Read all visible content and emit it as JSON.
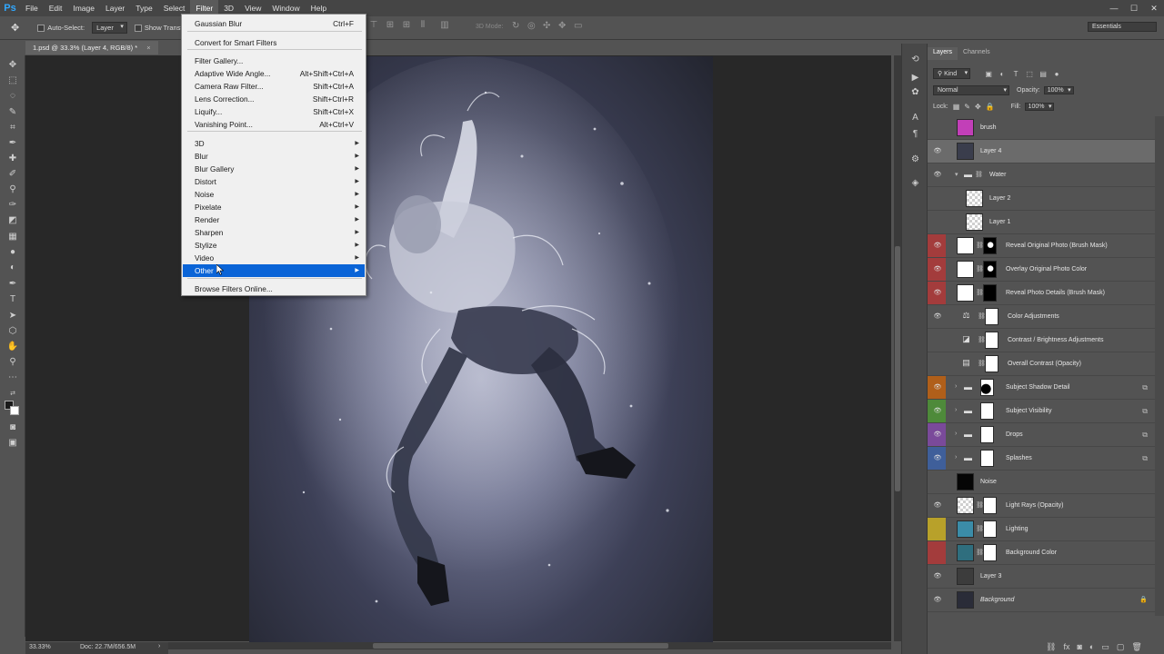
{
  "app": {
    "logo": "Ps"
  },
  "menubar": {
    "items": [
      "File",
      "Edit",
      "Image",
      "Layer",
      "Type",
      "Select",
      "Filter",
      "3D",
      "View",
      "Window",
      "Help"
    ],
    "active": "Filter",
    "window_controls": [
      "—",
      "☐",
      "✕"
    ]
  },
  "options_bar": {
    "auto_select_label": "Auto-Select:",
    "auto_select_value": "Layer",
    "show_transform_label": "Show Transf",
    "mode_3d_label": "3D Mode:",
    "workspace": "Essentials"
  },
  "document_tab": {
    "title": "1.psd @ 33.3% (Layer 4, RGB/8) *",
    "close": "×"
  },
  "filter_menu": {
    "items": [
      {
        "label": "Gaussian Blur",
        "shortcut": "Ctrl+F"
      },
      {
        "label": "Convert for Smart Filters",
        "shortcut": ""
      },
      {
        "label": "Filter Gallery...",
        "shortcut": ""
      },
      {
        "label": "Adaptive Wide Angle...",
        "shortcut": "Alt+Shift+Ctrl+A"
      },
      {
        "label": "Camera Raw Filter...",
        "shortcut": "Shift+Ctrl+A"
      },
      {
        "label": "Lens Correction...",
        "shortcut": "Shift+Ctrl+R"
      },
      {
        "label": "Liquify...",
        "shortcut": "Shift+Ctrl+X"
      },
      {
        "label": "Vanishing Point...",
        "shortcut": "Alt+Ctrl+V"
      },
      {
        "label": "3D",
        "submenu": true
      },
      {
        "label": "Blur",
        "submenu": true
      },
      {
        "label": "Blur Gallery",
        "submenu": true
      },
      {
        "label": "Distort",
        "submenu": true
      },
      {
        "label": "Noise",
        "submenu": true
      },
      {
        "label": "Pixelate",
        "submenu": true
      },
      {
        "label": "Render",
        "submenu": true
      },
      {
        "label": "Sharpen",
        "submenu": true
      },
      {
        "label": "Stylize",
        "submenu": true
      },
      {
        "label": "Video",
        "submenu": true
      },
      {
        "label": "Other",
        "submenu": true,
        "highlighted": true
      },
      {
        "label": "Browse Filters Online...",
        "shortcut": ""
      }
    ]
  },
  "layers_panel": {
    "tabs": [
      "Layers",
      "Channels"
    ],
    "active_tab": "Layers",
    "filter_kind": "Kind",
    "blend_mode": "Normal",
    "opacity_label": "Opacity:",
    "opacity_value": "100%",
    "lock_label": "Lock:",
    "fill_label": "Fill:",
    "fill_value": "100%",
    "layers": [
      {
        "name": "brush",
        "visible": false,
        "type": "pixel",
        "thumb": "#c23fb8"
      },
      {
        "name": "Layer 4",
        "visible": true,
        "type": "pixel",
        "thumb": "#3a3d4c",
        "selected": true
      },
      {
        "name": "Water",
        "visible": true,
        "type": "group",
        "expanded": true
      },
      {
        "name": "Layer 2",
        "visible": false,
        "type": "pixel",
        "thumb": "checker",
        "indent": true
      },
      {
        "name": "Layer 1",
        "visible": false,
        "type": "pixel",
        "thumb": "checker",
        "indent": true
      },
      {
        "name": "Reveal Original Photo (Brush Mask)",
        "visible": true,
        "color": "#a33c3c",
        "type": "masked",
        "thumb": "#ffffff",
        "mask": "dark"
      },
      {
        "name": "Overlay Original Photo Color",
        "visible": true,
        "color": "#a33c3c",
        "type": "masked",
        "thumb": "#ffffff",
        "mask": "dark"
      },
      {
        "name": "Reveal Photo Details (Brush Mask)",
        "visible": true,
        "color": "#a33c3c",
        "type": "masked",
        "thumb": "#ffffff",
        "mask": "black"
      },
      {
        "name": "Color Adjustments",
        "visible": true,
        "type": "adjustment",
        "icon": "⚖"
      },
      {
        "name": "Contrast / Brightness Adjustments",
        "visible": false,
        "type": "adjustment",
        "icon": "◪"
      },
      {
        "name": "Overall Contrast (Opacity)",
        "visible": false,
        "type": "adjustment",
        "icon": "▤"
      },
      {
        "name": "Subject Shadow Detail",
        "visible": true,
        "color": "#b05f1a",
        "type": "group-mask",
        "mask": "shadow"
      },
      {
        "name": "Subject Visibility",
        "visible": true,
        "color": "#4e8a3a",
        "type": "group-mask",
        "mask": "white"
      },
      {
        "name": "Drops",
        "visible": true,
        "color": "#7a4a9a",
        "type": "group-mask",
        "mask": "white"
      },
      {
        "name": "Splashes",
        "visible": true,
        "color": "#3f5f9a",
        "type": "group-mask",
        "mask": "white"
      },
      {
        "name": "Noise",
        "visible": false,
        "type": "pixel",
        "thumb": "#050505"
      },
      {
        "name": "Light Rays (Opacity)",
        "visible": true,
        "type": "masked",
        "thumb": "checker",
        "mask": "white"
      },
      {
        "name": "Lighting",
        "visible": false,
        "color": "#b8a12a",
        "type": "masked",
        "thumb": "#3b8ca8",
        "mask": "white"
      },
      {
        "name": "Background Color",
        "visible": false,
        "color": "#a33c3c",
        "type": "masked",
        "thumb": "#2f6e7e",
        "mask": "white"
      },
      {
        "name": "Layer 3",
        "visible": true,
        "type": "pixel",
        "thumb": "#3c3c3c"
      },
      {
        "name": "Background",
        "visible": true,
        "type": "background",
        "thumb": "#2a2c38",
        "italic": true
      }
    ]
  },
  "status_bar": {
    "zoom": "33.33%",
    "doc_size": "Doc: 22.7M/656.5M",
    "arrow": "›"
  }
}
